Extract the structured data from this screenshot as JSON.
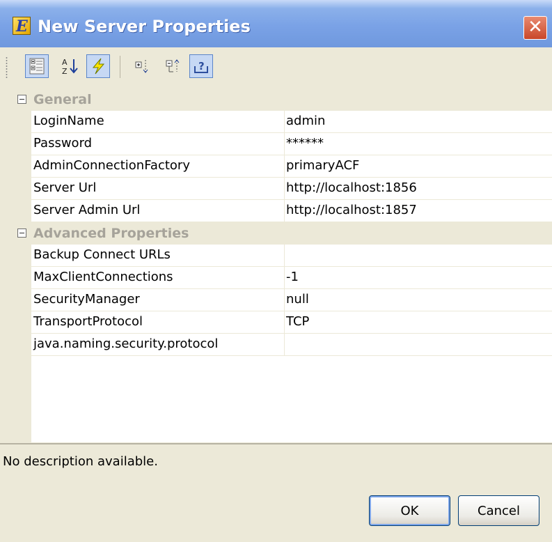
{
  "window": {
    "title": "New Server Properties",
    "app_icon_letter": "E",
    "close_glyph": "✕"
  },
  "toolbar": {
    "buttons": [
      {
        "name": "categorized-view-icon",
        "active": true
      },
      {
        "name": "sort-alphabetical-icon",
        "active": false
      },
      {
        "name": "events-lightning-icon",
        "active": true
      },
      {
        "name": "expand-all-icon",
        "active": false
      },
      {
        "name": "collapse-all-icon",
        "active": false
      },
      {
        "name": "help-description-icon",
        "active": true
      }
    ]
  },
  "categories": [
    {
      "label": "General",
      "properties": [
        {
          "name": "LoginName",
          "value": "admin"
        },
        {
          "name": "Password",
          "value": "******"
        },
        {
          "name": "AdminConnectionFactory",
          "value": "primaryACF"
        },
        {
          "name": "Server Url",
          "value": "http://localhost:1856"
        },
        {
          "name": "Server Admin Url",
          "value": "http://localhost:1857"
        }
      ]
    },
    {
      "label": "Advanced Properties",
      "properties": [
        {
          "name": "Backup Connect URLs",
          "value": ""
        },
        {
          "name": "MaxClientConnections",
          "value": "-1"
        },
        {
          "name": "SecurityManager",
          "value": "null"
        },
        {
          "name": "TransportProtocol",
          "value": "TCP"
        },
        {
          "name": "java.naming.security.protocol",
          "value": ""
        }
      ]
    }
  ],
  "description": "No description available.",
  "buttons": {
    "ok": "OK",
    "cancel": "Cancel"
  },
  "colors": {
    "titlebar": "#7aa2e6",
    "window_bg": "#ece9d8",
    "grid_bg": "#ffffff",
    "category_text": "#a6a39a"
  }
}
